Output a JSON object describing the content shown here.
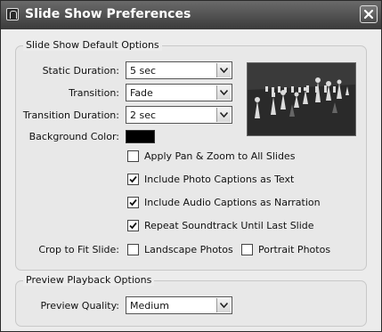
{
  "window": {
    "title": "Slide Show Preferences"
  },
  "default_options": {
    "legend": "Slide Show Default Options",
    "static_duration": {
      "label": "Static Duration:",
      "value": "5 sec"
    },
    "transition": {
      "label": "Transition:",
      "value": "Fade"
    },
    "transition_duration": {
      "label": "Transition Duration:",
      "value": "2 sec"
    },
    "background_color": {
      "label": "Background Color:",
      "color": "#000000"
    },
    "checkboxes": [
      {
        "label": "Apply Pan & Zoom to All Slides",
        "checked": false
      },
      {
        "label": "Include Photo Captions as Text",
        "checked": true
      },
      {
        "label": "Include Audio Captions as Narration",
        "checked": true
      },
      {
        "label": "Repeat Soundtrack Until Last Slide",
        "checked": true
      }
    ],
    "crop": {
      "label": "Crop to Fit Slide:",
      "landscape": {
        "label": "Landscape Photos",
        "checked": false
      },
      "portrait": {
        "label": "Portrait Photos",
        "checked": false
      }
    }
  },
  "preview_options": {
    "legend": "Preview Playback Options",
    "quality": {
      "label": "Preview Quality:",
      "value": "Medium"
    }
  },
  "icons": [
    "app-icon",
    "close-icon",
    "chevron-down-icon",
    "checkmark-icon"
  ]
}
